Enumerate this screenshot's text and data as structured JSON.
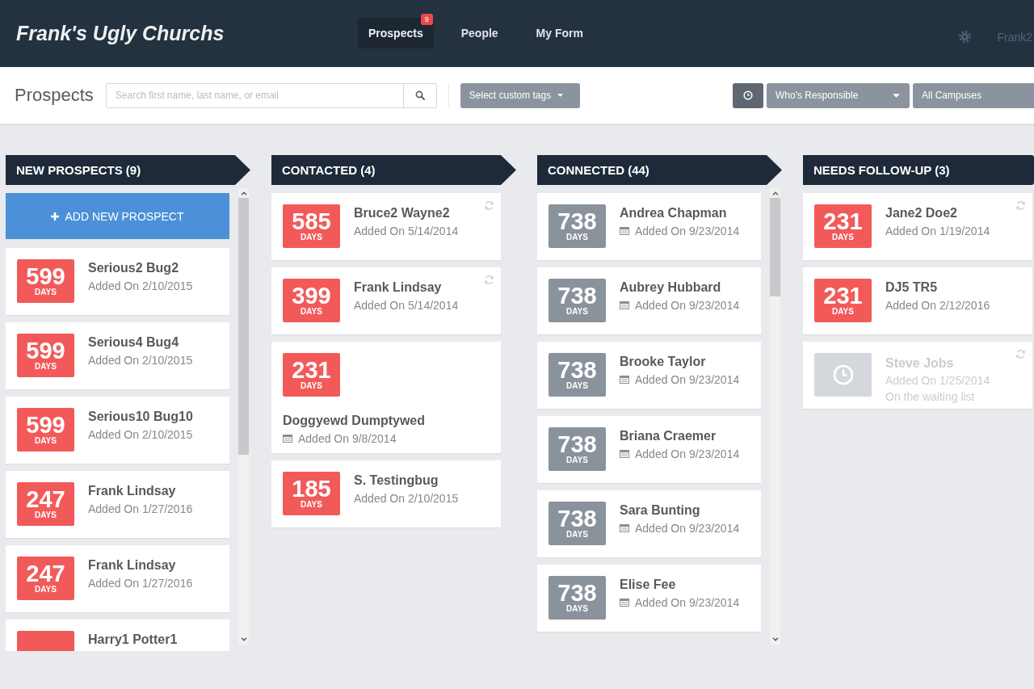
{
  "brand": "Frank's Ugly Churchs",
  "nav": [
    {
      "label": "Prospects",
      "selected": true,
      "badge": "9"
    },
    {
      "label": "People",
      "selected": false
    },
    {
      "label": "My Form",
      "selected": false
    }
  ],
  "user": "Frank2",
  "toolbar": {
    "title": "Prospects",
    "search": {
      "placeholder": "Search first name, last name, or email"
    },
    "tags": {
      "label": "Select custom tags"
    },
    "filters": [
      {
        "label": "Who's Responsible",
        "caret": true
      },
      {
        "label": "All Campuses",
        "caret": false
      }
    ]
  },
  "columns": [
    {
      "title": "NEW PROSPECTS (9)",
      "add_button": "ADD NEW PROSPECT",
      "scrollable": true,
      "cards": [
        {
          "kind": "inline",
          "days": "599",
          "unit": "DAYS",
          "color": "#f25a5a",
          "name": "Serious2 Bug2",
          "added": "Added On 2/10/2015",
          "date_icon": false,
          "refreshable": false
        },
        {
          "kind": "inline",
          "days": "599",
          "unit": "DAYS",
          "color": "#f25a5a",
          "name": "Serious4 Bug4",
          "added": "Added On 2/10/2015",
          "date_icon": false,
          "refreshable": false
        },
        {
          "kind": "inline",
          "days": "599",
          "unit": "DAYS",
          "color": "#f25a5a",
          "name": "Serious10 Bug10",
          "added": "Added On 2/10/2015",
          "date_icon": false,
          "refreshable": false
        },
        {
          "kind": "inline",
          "days": "247",
          "unit": "DAYS",
          "color": "#f25a5a",
          "name": "Frank Lindsay",
          "added": "Added On 1/27/2016",
          "date_icon": false,
          "refreshable": false
        },
        {
          "kind": "inline",
          "days": "247",
          "unit": "DAYS",
          "color": "#f25a5a",
          "name": "Frank Lindsay",
          "added": "Added On 1/27/2016",
          "date_icon": false,
          "refreshable": false
        },
        {
          "kind": "inline",
          "color": "#f25a5a",
          "name": "Harry1 Potter1",
          "date_icon": false,
          "refreshable": false
        }
      ]
    },
    {
      "title": "CONTACTED (4)",
      "scrollable": false,
      "cards": [
        {
          "kind": "inline",
          "days": "585",
          "unit": "DAYS",
          "color": "#f25a5a",
          "name": "Bruce2 Wayne2",
          "added": "Added On 5/14/2014",
          "date_icon": false,
          "refreshable": true
        },
        {
          "kind": "inline",
          "days": "399",
          "unit": "DAYS",
          "color": "#f25a5a",
          "name": "Frank Lindsay",
          "added": "Added On 5/14/2014",
          "date_icon": false,
          "refreshable": true
        },
        {
          "kind": "stacked",
          "days": "231",
          "unit": "DAYS",
          "color": "#f25a5a",
          "name": "Doggyewd Dumptywed",
          "added": "Added On 9/8/2014",
          "date_icon": true,
          "refreshable": false
        },
        {
          "kind": "inline",
          "days": "185",
          "unit": "DAYS",
          "color": "#f25a5a",
          "name": "S. Testingbug",
          "added": "Added On 2/10/2015",
          "date_icon": false,
          "refreshable": false
        }
      ]
    },
    {
      "title": "CONNECTED (44)",
      "scrollable": true,
      "cards": [
        {
          "kind": "inline",
          "days": "738",
          "unit": "DAYS",
          "color": "#8a929c",
          "name": "Andrea Chapman",
          "added": "Added On 9/23/2014",
          "date_icon": true,
          "refreshable": false
        },
        {
          "kind": "inline",
          "days": "738",
          "unit": "DAYS",
          "color": "#8a929c",
          "name": "Aubrey Hubbard",
          "added": "Added On 9/23/2014",
          "date_icon": true,
          "refreshable": false
        },
        {
          "kind": "inline",
          "days": "738",
          "unit": "DAYS",
          "color": "#8a929c",
          "name": "Brooke Taylor",
          "added": "Added On 9/23/2014",
          "date_icon": true,
          "refreshable": false
        },
        {
          "kind": "inline",
          "days": "738",
          "unit": "DAYS",
          "color": "#8a929c",
          "name": "Briana Craemer",
          "added": "Added On 9/23/2014",
          "date_icon": true,
          "refreshable": false
        },
        {
          "kind": "inline",
          "days": "738",
          "unit": "DAYS",
          "color": "#8a929c",
          "name": "Sara Bunting",
          "added": "Added On 9/23/2014",
          "date_icon": true,
          "refreshable": false
        },
        {
          "kind": "inline",
          "days": "738",
          "unit": "DAYS",
          "color": "#8a929c",
          "name": "Elise Fee",
          "added": "Added On 9/23/2014",
          "date_icon": true,
          "refreshable": false
        }
      ]
    },
    {
      "title": "NEEDS FOLLOW-UP (3)",
      "scrollable": false,
      "cards": [
        {
          "kind": "inline",
          "days": "231",
          "unit": "DAYS",
          "color": "#f25a5a",
          "name": "Jane2 Doe2",
          "added": "Added On 1/19/2014",
          "date_icon": false,
          "refreshable": true
        },
        {
          "kind": "inline",
          "days": "231",
          "unit": "DAYS",
          "color": "#f25a5a",
          "name": "DJ5 TR5",
          "added": "Added On 2/12/2016",
          "date_icon": false,
          "refreshable": false
        },
        {
          "kind": "waiting",
          "color": "#d4d7db",
          "name": "Steve Jobs",
          "added": "Added On 1/25/2014",
          "note": "On the waiting list",
          "date_icon": false,
          "refreshable": true
        }
      ]
    }
  ]
}
